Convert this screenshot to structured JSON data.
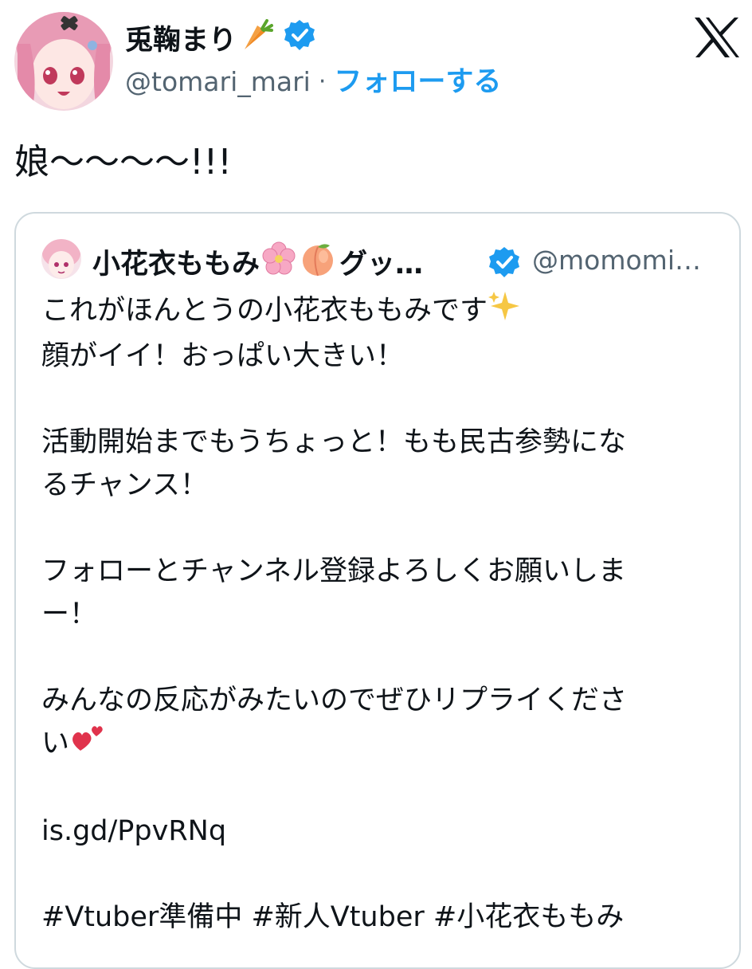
{
  "author": {
    "name": "兎鞠まり",
    "name_emoji_icon": "carrot-icon",
    "verified_icon": "verified-badge-icon",
    "handle": "@tomari_mari",
    "separator": "·",
    "follow_label": "フォローする"
  },
  "brand_icon": "x-logo-icon",
  "tweet": {
    "text": "娘〜〜〜〜!!!"
  },
  "quote": {
    "name": "小花衣ももみ",
    "name_emojis": [
      "cherry-blossom-icon",
      "peach-icon"
    ],
    "name_suffix": "グッ…",
    "handle": "@momomi…",
    "body": {
      "line1": "これがほんとうの小花衣ももみです",
      "line2": "顔がイイ！おっぱい大きい！",
      "line3": "活動開始までもうちょっと！もも民古参勢にな",
      "line4": "るチャンス！",
      "line5": "フォローとチャンネル登録よろしくお願いしま",
      "line6": "ー！",
      "line7": "みんなの反応がみたいのでぜひリプライくださ",
      "line8": "い",
      "link": "is.gd/PpvRNq",
      "hashtags": "#Vtuber準備中 #新人Vtuber #小花衣ももみ"
    }
  },
  "colors": {
    "accent": "#1d9bf0",
    "secondary_text": "#536471",
    "border": "#cfd9de"
  }
}
